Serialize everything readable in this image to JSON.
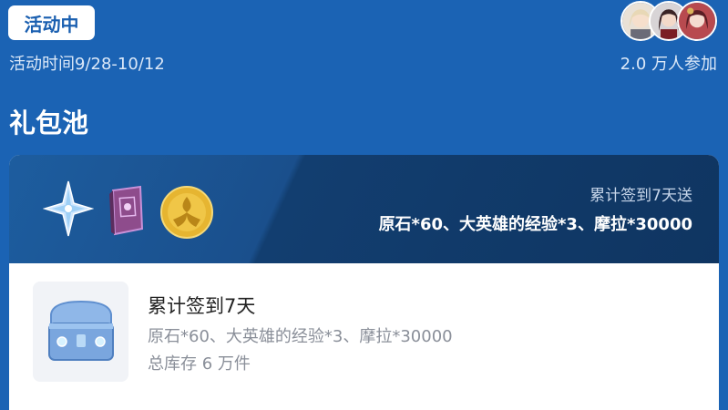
{
  "header": {
    "status_badge": "活动中",
    "activity_time": "活动时间9/28-10/12",
    "participants": "2.0 万人参加"
  },
  "section": {
    "title": "礼包池"
  },
  "banner": {
    "icons": [
      "primogem-icon",
      "heros-wit-book-icon",
      "mora-coin-icon"
    ],
    "subtitle": "累计签到7天送",
    "rewards": "原石*60、大英雄的经验*3、摩拉*30000"
  },
  "gift_item": {
    "icon": "treasure-chest-icon",
    "title": "累计签到7天",
    "description": "原石*60、大英雄的经验*3、摩拉*30000",
    "stock": "总库存 6 万件"
  },
  "colors": {
    "background": "#1b63b4",
    "badge_text": "#1a5fb0",
    "banner_dark": "#0f3561",
    "muted_text": "#8a8f99"
  }
}
